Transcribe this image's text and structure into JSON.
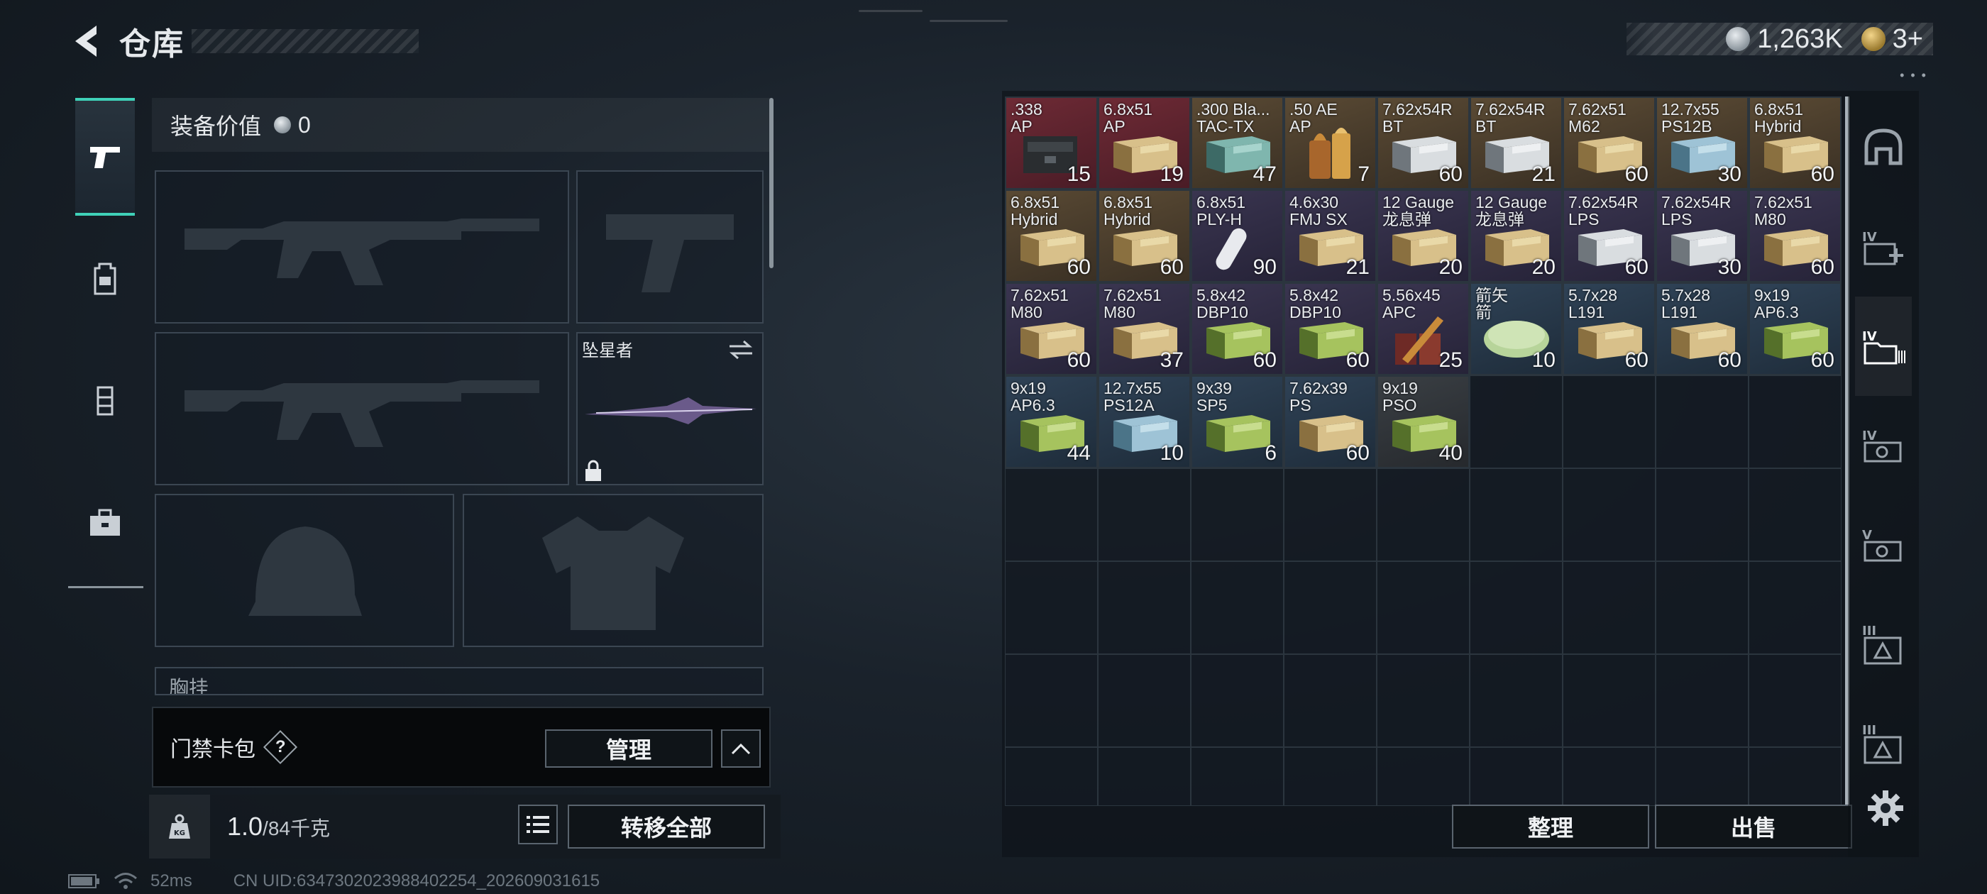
{
  "header": {
    "title": "仓库"
  },
  "currency": [
    {
      "icon": "silver-coin-icon",
      "value": "1,263K"
    },
    {
      "icon": "gold-coin-icon",
      "value": "3+"
    }
  ],
  "left_tabs": [
    {
      "icon": "pistol-icon",
      "active": true
    },
    {
      "icon": "backpack-icon",
      "active": false
    },
    {
      "icon": "chest-rig-icon",
      "active": false
    },
    {
      "icon": "toolbox-icon",
      "active": false
    }
  ],
  "equipment": {
    "value_label": "装备价值",
    "value": "0",
    "melee_name": "坠星者",
    "chest_label": "胸挂",
    "card_label": "门禁卡包",
    "help": "?",
    "manage_button": "管理",
    "weight_current": "1.0",
    "weight_max": "/84千克",
    "transfer_button": "转移全部"
  },
  "storage": {
    "items": [
      {
        "name": ".338\nAP",
        "count": "15",
        "rarity": "red",
        "art": "ammo-can"
      },
      {
        "name": "6.8x51\nAP",
        "count": "19",
        "rarity": "red",
        "art": "box-tan"
      },
      {
        "name": ".300 Bla...\nTAC-TX",
        "count": "47",
        "rarity": "gold",
        "art": "box-teal"
      },
      {
        "name": ".50 AE\nAP",
        "count": "7",
        "rarity": "gold",
        "art": "bullet"
      },
      {
        "name": "7.62x54R\nBT",
        "count": "60",
        "rarity": "gold",
        "art": "box-white"
      },
      {
        "name": "7.62x54R\nBT",
        "count": "21",
        "rarity": "gold",
        "art": "box-white"
      },
      {
        "name": "7.62x51\nM62",
        "count": "60",
        "rarity": "gold",
        "art": "box-tan"
      },
      {
        "name": "12.7x55\nPS12B",
        "count": "30",
        "rarity": "gold",
        "art": "box-blue"
      },
      {
        "name": "6.8x51\nHybrid",
        "count": "60",
        "rarity": "gold",
        "art": "box-tan"
      },
      {
        "name": "6.8x51\nHybrid",
        "count": "60",
        "rarity": "gold",
        "art": "box-tan"
      },
      {
        "name": "6.8x51\nHybrid",
        "count": "60",
        "rarity": "gold",
        "art": "box-tan"
      },
      {
        "name": "6.8x51\nPLY-H",
        "count": "90",
        "rarity": "purple",
        "art": "capsule"
      },
      {
        "name": "4.6x30\nFMJ SX",
        "count": "21",
        "rarity": "purple",
        "art": "box-tan"
      },
      {
        "name": "12 Gauge\n龙息弹",
        "count": "20",
        "rarity": "purple",
        "art": "box-tan"
      },
      {
        "name": "12 Gauge\n龙息弹",
        "count": "20",
        "rarity": "purple",
        "art": "box-tan"
      },
      {
        "name": "7.62x54R\nLPS",
        "count": "60",
        "rarity": "purple",
        "art": "box-white"
      },
      {
        "name": "7.62x54R\nLPS",
        "count": "30",
        "rarity": "purple",
        "art": "box-white"
      },
      {
        "name": "7.62x51\nM80",
        "count": "60",
        "rarity": "purple",
        "art": "box-tan"
      },
      {
        "name": "7.62x51\nM80",
        "count": "60",
        "rarity": "purple",
        "art": "box-tan"
      },
      {
        "name": "7.62x51\nM80",
        "count": "37",
        "rarity": "purple",
        "art": "box-tan"
      },
      {
        "name": "5.8x42\nDBP10",
        "count": "60",
        "rarity": "purple",
        "art": "box-green"
      },
      {
        "name": "5.8x42\nDBP10",
        "count": "60",
        "rarity": "purple",
        "art": "box-green"
      },
      {
        "name": "5.56x45\nAPC",
        "count": "25",
        "rarity": "purple",
        "art": "bullet-red"
      },
      {
        "name": "箭矢\n箭",
        "count": "10",
        "rarity": "blue",
        "art": "tin"
      },
      {
        "name": "5.7x28\nL191",
        "count": "60",
        "rarity": "blue",
        "art": "box-tan"
      },
      {
        "name": "5.7x28\nL191",
        "count": "60",
        "rarity": "blue",
        "art": "box-tan"
      },
      {
        "name": "9x19\nAP6.3",
        "count": "60",
        "rarity": "blue",
        "art": "box-green"
      },
      {
        "name": "9x19\nAP6.3",
        "count": "44",
        "rarity": "blue",
        "art": "box-green"
      },
      {
        "name": "12.7x55\nPS12A",
        "count": "10",
        "rarity": "blue",
        "art": "box-blue"
      },
      {
        "name": "9x39\nSP5",
        "count": "6",
        "rarity": "blue",
        "art": "box-green"
      },
      {
        "name": "7.62x39\nPS",
        "count": "60",
        "rarity": "blue",
        "art": "box-tan"
      },
      {
        "name": "9x19\nPSO",
        "count": "40",
        "rarity": "gray",
        "art": "box-green"
      }
    ],
    "sort_button": "整理",
    "sell_button": "出售"
  },
  "right_tabs": [
    {
      "icon": "helmet-category-icon"
    },
    {
      "icon": "medical-iv-icon"
    },
    {
      "icon": "ammo-iv-folder-icon",
      "active": true
    },
    {
      "icon": "armor-iv-icon"
    },
    {
      "icon": "armor-v-icon"
    },
    {
      "icon": "container-iii-icon"
    },
    {
      "icon": "container-iii-b-icon"
    }
  ],
  "status_bar": {
    "ping": "52ms",
    "uid": "CN UID:6347302023988402254_202609031615"
  },
  "colors": {
    "accent": "#3fd1b8",
    "rarity_red": "#6e2a35",
    "rarity_gold": "#5a4a34",
    "rarity_purple": "#3a3550",
    "rarity_blue": "#2f4256",
    "rarity_gray": "#3a3f44"
  }
}
